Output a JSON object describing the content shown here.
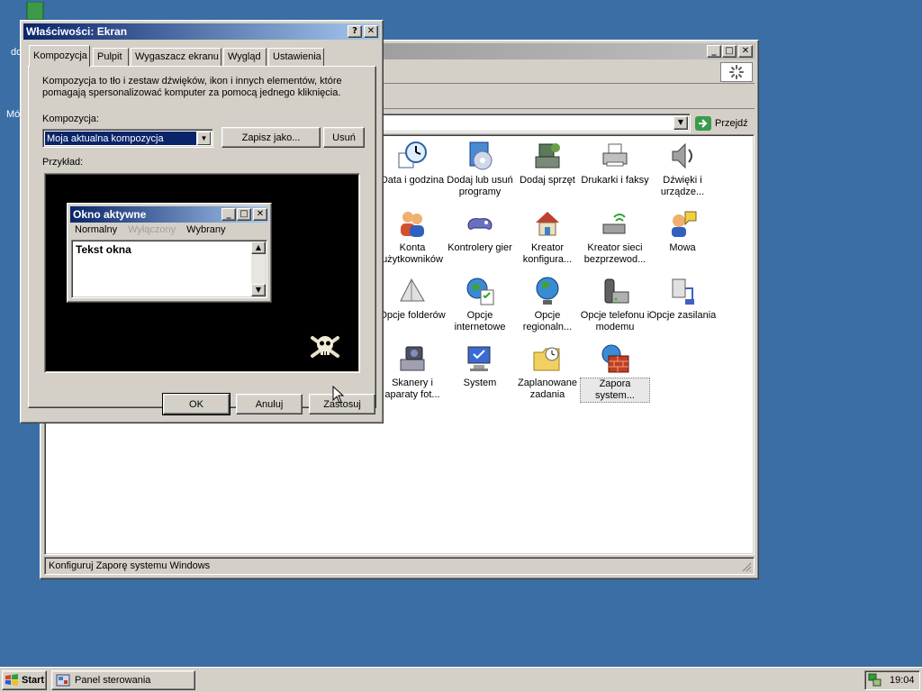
{
  "desktop": {
    "partial_labels": [
      "do",
      "Mó"
    ]
  },
  "control_panel": {
    "go_label": "Przejdź",
    "status_text": "Konfiguruj Zaporę systemu Windows",
    "items": [
      {
        "label": "Data i godzina",
        "icon": "clock-icon"
      },
      {
        "label": "Dodaj lub usuń programy",
        "icon": "add-remove-programs-icon"
      },
      {
        "label": "Dodaj sprzęt",
        "icon": "add-hardware-icon"
      },
      {
        "label": "Drukarki i faksy",
        "icon": "printer-icon"
      },
      {
        "label": "Dźwięki i urządze...",
        "icon": "speaker-icon"
      },
      {
        "label": "Konta użytkowników",
        "icon": "user-accounts-icon"
      },
      {
        "label": "Kontrolery gier",
        "icon": "gamepad-icon"
      },
      {
        "label": "Kreator konfigura...",
        "icon": "network-house-icon"
      },
      {
        "label": "Kreator sieci bezprzewod...",
        "icon": "wireless-icon"
      },
      {
        "label": "Mowa",
        "icon": "speech-icon"
      },
      {
        "label": "Opcje folderów",
        "icon": "folder-options-icon"
      },
      {
        "label": "Opcje internetowe",
        "icon": "internet-options-icon"
      },
      {
        "label": "Opcje regionaln...",
        "icon": "globe-icon"
      },
      {
        "label": "Opcje telefonu i modemu",
        "icon": "phone-modem-icon"
      },
      {
        "label": "Opcje zasilania",
        "icon": "power-icon"
      },
      {
        "label": "Skanery i aparaty fot...",
        "icon": "scanner-camera-icon"
      },
      {
        "label": "System",
        "icon": "system-icon"
      },
      {
        "label": "Zaplanowane zadania",
        "icon": "scheduled-tasks-icon"
      },
      {
        "label": "Zapora system...",
        "icon": "firewall-icon"
      }
    ]
  },
  "dialog": {
    "title": "Właściwości: Ekran",
    "help_button": "?",
    "close_button": "✕",
    "tabs": [
      "Kompozycja",
      "Pulpit",
      "Wygaszacz ekranu",
      "Wygląd",
      "Ustawienia"
    ],
    "active_tab": "Kompozycja",
    "description": "Kompozycja to tło i zestaw dźwięków, ikon i innych elementów, które pomagają spersonalizować komputer za pomocą jednego kliknięcia.",
    "theme_label": "Kompozycja:",
    "theme_value": "Moja aktualna kompozycja",
    "save_as_label": "Zapisz jako...",
    "delete_label": "Usuń",
    "preview_label": "Przykład:",
    "preview": {
      "window_title": "Okno aktywne",
      "menu_normal": "Normalny",
      "menu_disabled": "Wyłączony",
      "menu_selected": "Wybrany",
      "window_text": "Tekst okna"
    },
    "ok_label": "OK",
    "cancel_label": "Anuluj",
    "apply_label": "Zastosuj"
  },
  "taskbar": {
    "start_label": "Start",
    "task_label": "Panel sterowania",
    "clock": "19:04"
  }
}
